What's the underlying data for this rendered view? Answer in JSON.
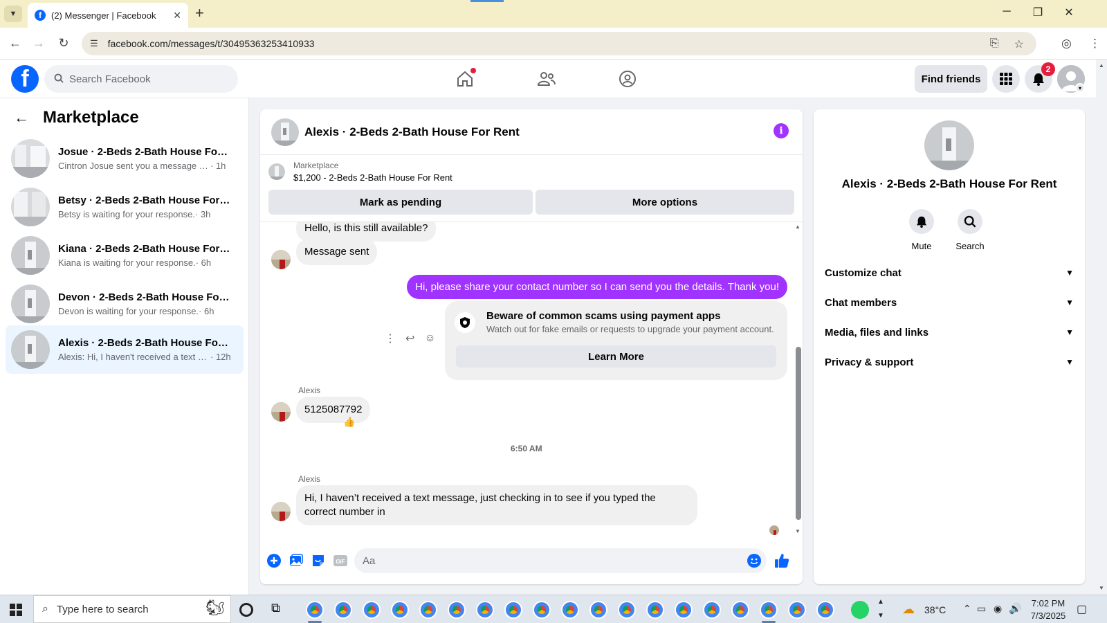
{
  "browser": {
    "tab_title": "(2) Messenger | Facebook",
    "url": "facebook.com/messages/t/30495363253410933"
  },
  "fb": {
    "search_placeholder": "Search Facebook",
    "find_friends": "Find friends",
    "notification_count": "2"
  },
  "sidebar": {
    "title": "Marketplace",
    "conversations": [
      {
        "name": "Josue · 2-Beds 2-Bath House For R...",
        "snippet": "Cintron Josue sent you a message ab...",
        "time": "· 1h",
        "active": false
      },
      {
        "name": "Betsy · 2-Beds 2-Bath House For R...",
        "snippet": "Betsy is waiting for your response.",
        "time": "· 3h",
        "active": false
      },
      {
        "name": "Kiana · 2-Beds 2-Bath House For R...",
        "snippet": "Kiana is waiting for your response.",
        "time": "· 6h",
        "active": false
      },
      {
        "name": "Devon · 2-Beds 2-Bath House For ...",
        "snippet": "Devon is waiting for your response.",
        "time": "· 6h",
        "active": false
      },
      {
        "name": "Alexis · 2-Beds 2-Bath House For R...",
        "snippet": "Alexis: Hi, I haven't received a text m...",
        "time": "· 12h",
        "active": true
      }
    ]
  },
  "chat": {
    "title": "Alexis · 2-Beds 2-Bath House For Rent",
    "listing_label": "Marketplace",
    "listing_price": "$1,200 - 2-Beds 2-Bath House For Rent",
    "mark_pending": "Mark as pending",
    "more_options": "More options",
    "messages": {
      "m1": "Hello, is this still available?",
      "m2": "Message sent",
      "m3": "Hi, please share your contact number so I can send you the details. Thank you!",
      "scam_title": "Beware of common scams using payment apps",
      "scam_text": "Watch out for fake emails or requests to upgrade your payment account.",
      "learn_more": "Learn More",
      "sender1": "Alexis",
      "m4": "5125087792",
      "timestamp": "6:50 AM",
      "sender2": "Alexis",
      "m5": "Hi, I haven’t received a text message, just checking in to see if you typed the correct number in"
    },
    "composer_placeholder": "Aa"
  },
  "info": {
    "name": "Alexis · 2-Beds 2-Bath House For Rent",
    "mute": "Mute",
    "search": "Search",
    "sections": [
      "Customize chat",
      "Chat members",
      "Media, files and links",
      "Privacy & support"
    ]
  },
  "taskbar": {
    "search_placeholder": "Type here to search",
    "temperature": "38°C",
    "time": "7:02 PM",
    "date": "7/3/2025"
  },
  "colors": {
    "messenger_accent": "#a033ff",
    "fb_blue": "#0866ff"
  }
}
